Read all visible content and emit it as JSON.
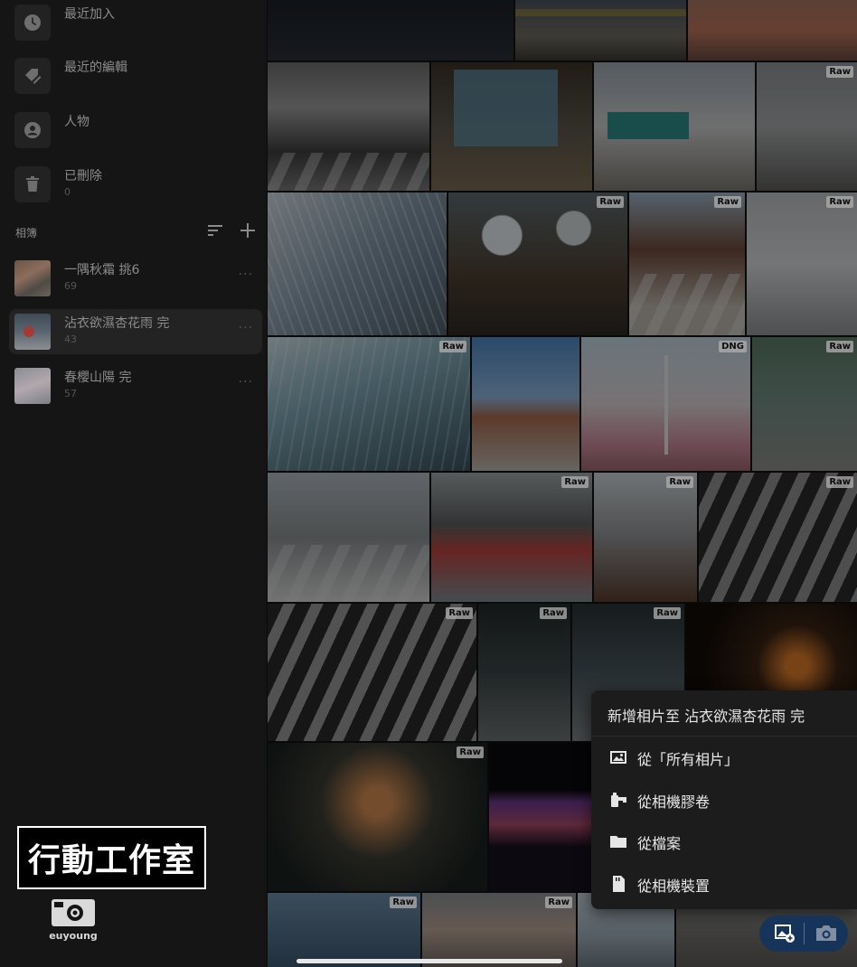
{
  "sidebar": {
    "nav": [
      {
        "label": "最近加入",
        "sub": "",
        "icon": "clock-icon"
      },
      {
        "label": "最近的編輯",
        "sub": "",
        "icon": "tag-edit-icon"
      },
      {
        "label": "人物",
        "sub": "",
        "icon": "person-icon"
      },
      {
        "label": "已刪除",
        "sub": "0",
        "icon": "trash-icon"
      }
    ],
    "albums_header": "相簿",
    "albums": [
      {
        "title": "一隅秋霜 挑6",
        "count": "69",
        "selected": false
      },
      {
        "title": "沾衣欲濕杏花雨 完",
        "count": "43",
        "selected": true
      },
      {
        "title": "春櫻山陽 完",
        "count": "57",
        "selected": false
      }
    ],
    "more_glyph": "···"
  },
  "watermark": {
    "text": "行動工作室",
    "logo_text": "euyoung"
  },
  "grid": {
    "badges": [
      "Raw",
      "Raw",
      "Raw",
      "Raw",
      "Raw",
      "DNG",
      "Raw",
      "Raw",
      "Raw",
      "Raw",
      "Raw",
      "Raw",
      "Raw",
      "Raw",
      "Raw",
      "Raw"
    ]
  },
  "popup": {
    "title": "新增相片至 沾衣欲濕杏花雨 完",
    "items": [
      {
        "label": "從「所有相片」",
        "icon": "image-icon"
      },
      {
        "label": "從相機膠卷",
        "icon": "film-roll-icon"
      },
      {
        "label": "從檔案",
        "icon": "folder-icon"
      },
      {
        "label": "從相機裝置",
        "icon": "sd-card-icon"
      }
    ]
  },
  "colors": {
    "sidebar_bg": "#151515",
    "popup_bg": "#1c1c1c",
    "pill_bg": "#16345a",
    "watermark_border": "#ffffff"
  }
}
